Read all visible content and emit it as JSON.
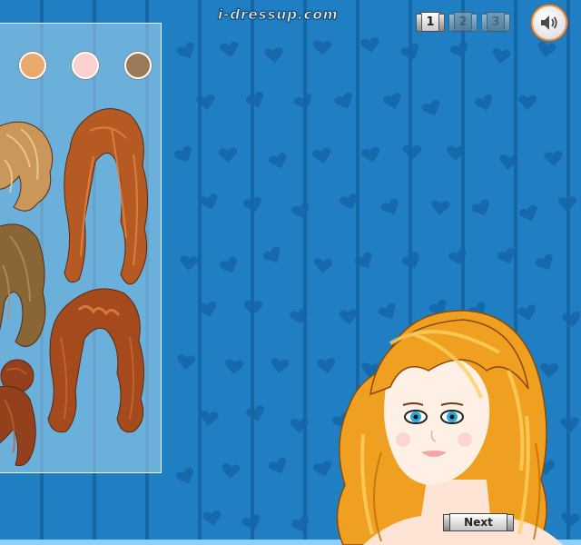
{
  "site": {
    "logo_text": "i-dressup.com"
  },
  "pagination": {
    "pages": [
      {
        "label": "1",
        "state": "active"
      },
      {
        "label": "2",
        "state": "inactive"
      },
      {
        "label": "3",
        "state": "inactive"
      }
    ]
  },
  "sound": {
    "icon": "speaker-icon",
    "state": "on"
  },
  "panel": {
    "category": "hair",
    "swatches": [
      {
        "name": "tan",
        "color": "#e8a96a"
      },
      {
        "name": "pink",
        "color": "#fbd0cf"
      },
      {
        "name": "brown",
        "color": "#9b7a5a"
      }
    ],
    "hair_options": [
      {
        "style": "curly-blonde-partial",
        "color": "#c9975a"
      },
      {
        "style": "wavy-bangs-auburn",
        "color": "#b55a22"
      },
      {
        "style": "straight-brown-partial",
        "color": "#8a6535"
      },
      {
        "style": "braided-auburn",
        "color": "#a54a1c"
      },
      {
        "style": "bun-auburn-partial",
        "color": "#93401d"
      }
    ]
  },
  "character": {
    "hair_color": "#f0a020",
    "eye_color": "#2fa8d8"
  },
  "navigation": {
    "next_label": "Next"
  },
  "colors": {
    "background": "#1f7fc2",
    "panel_border": "#e6f5ff"
  }
}
